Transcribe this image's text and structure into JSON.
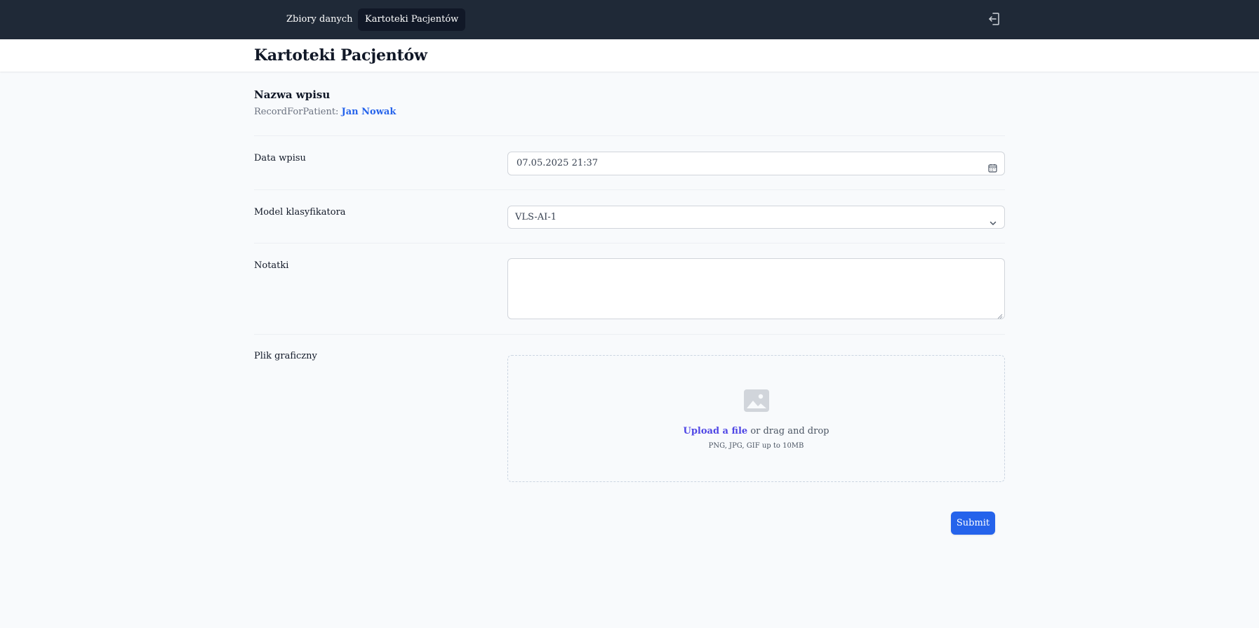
{
  "nav": {
    "items": [
      {
        "label": "Zbiory danych",
        "active": false
      },
      {
        "label": "Kartoteki Pacjentów",
        "active": true
      }
    ],
    "logout_icon": "logout-icon"
  },
  "header": {
    "title": "Kartoteki Pacjentów"
  },
  "form": {
    "section_title": "Nazwa wpisu",
    "record_prefix": "RecordForPatient:",
    "patient_name": "Jan Nowak",
    "fields": {
      "date": {
        "label": "Data wpisu",
        "value": "07.05.2025 21:37",
        "icon": "calendar-icon"
      },
      "model": {
        "label": "Model klasyfikatora",
        "value": "VLS-AI-1",
        "icon": "chevron-down-icon"
      },
      "notes": {
        "label": "Notatki",
        "value": ""
      },
      "image": {
        "label": "Plik graficzny",
        "icon": "photo-icon",
        "upload_link": "Upload a file",
        "upload_rest": "or drag and drop",
        "hint": "PNG, JPG, GIF up to 10MB"
      }
    },
    "submit_label": "Submit"
  },
  "colors": {
    "nav_bg": "#1f2937",
    "nav_active_bg": "#111827",
    "accent": "#2563eb",
    "upload_link": "#4f46e5",
    "page_bg": "#f8fafc"
  }
}
